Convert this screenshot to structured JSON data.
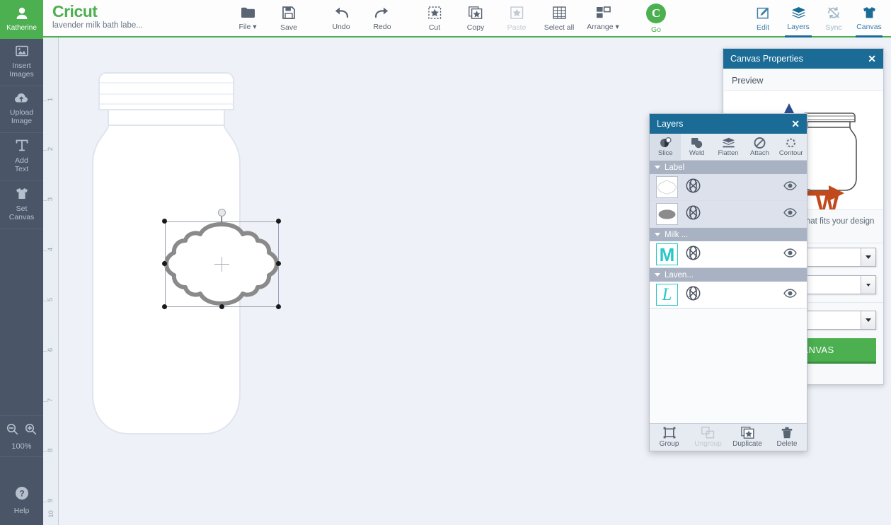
{
  "app": {
    "brand": "Cricut",
    "project_title": "lavender milk bath labe..."
  },
  "user": {
    "name": "Katherine",
    "avatar_icon": "person-icon",
    "caret_icon": "chevron-down-icon"
  },
  "left_rail": {
    "items": [
      {
        "label_line1": "Insert",
        "label_line2": "Images",
        "icon": "image-icon"
      },
      {
        "label_line1": "Upload",
        "label_line2": "Image",
        "icon": "cloud-upload-icon"
      },
      {
        "label_line1": "Add",
        "label_line2": "Text",
        "icon": "text-t-icon"
      },
      {
        "label_line1": "Set",
        "label_line2": "Canvas",
        "icon": "tshirt-icon"
      }
    ],
    "zoom_out_icon": "zoom-out-icon",
    "zoom_in_icon": "zoom-in-icon",
    "zoom_percent": "100%",
    "help_label": "Help",
    "help_icon": "question-mark-icon"
  },
  "toolbar": {
    "items": [
      {
        "label": "File",
        "icon": "folder-icon",
        "disabled": false,
        "has_caret": true
      },
      {
        "label": "Save",
        "icon": "floppy-disk-icon",
        "disabled": false,
        "has_caret": false
      },
      {
        "label": "Undo",
        "icon": "undo-arrow-icon",
        "disabled": false,
        "has_caret": false
      },
      {
        "label": "Redo",
        "icon": "redo-arrow-icon",
        "disabled": false,
        "has_caret": false
      },
      {
        "label": "Cut",
        "icon": "cut-icon",
        "disabled": false,
        "has_caret": false
      },
      {
        "label": "Copy",
        "icon": "copy-icon",
        "disabled": false,
        "has_caret": false
      },
      {
        "label": "Paste",
        "icon": "paste-icon",
        "disabled": true,
        "has_caret": false
      },
      {
        "label": "Select all",
        "icon": "grid-icon",
        "disabled": false,
        "has_caret": false
      },
      {
        "label": "Arrange",
        "icon": "arrange-icon",
        "disabled": false,
        "has_caret": true
      }
    ],
    "go": {
      "label": "Go",
      "icon": "cricut-c-icon"
    }
  },
  "right_tabs": [
    {
      "label": "Edit",
      "icon": "pencil-square-icon",
      "active": false,
      "dim": false
    },
    {
      "label": "Layers",
      "icon": "layers-stack-icon",
      "active": true,
      "dim": false
    },
    {
      "label": "Sync",
      "icon": "sync-slash-icon",
      "active": false,
      "dim": true
    },
    {
      "label": "Canvas",
      "icon": "tshirt-icon",
      "active": true,
      "dim": false
    }
  ],
  "ruler": {
    "ticks": [
      "1",
      "2",
      "3",
      "4",
      "5",
      "6",
      "7",
      "8",
      "9",
      "10"
    ]
  },
  "canvas": {
    "artwork_name": "mason-jar-outline",
    "selected_shape_name": "ornate-label-shape",
    "selection": {
      "handles": 8,
      "rotate_handle_icon": "rotate-handle-icon",
      "center_icon": "center-crosshair-icon"
    }
  },
  "canvas_properties": {
    "title": "Canvas Properties",
    "close_icon": "close-icon",
    "preview_label": "Preview",
    "preview_icon": "jar-dimension-preview",
    "hint_text": "Choose the canvas that fits your design best.",
    "fields": [
      {
        "name": "category-select",
        "value": "",
        "arrow_icon": "chevron-down-icon",
        "size": "normal"
      },
      {
        "name": "type-select",
        "value": "",
        "arrow_icon": "chevron-down-icon",
        "size": "small"
      },
      {
        "name": "size-select",
        "value": "",
        "arrow_icon": "chevron-down-icon",
        "size": "normal"
      }
    ],
    "button_label": "SET CANVAS",
    "button_color": "#4caf50"
  },
  "layers_panel": {
    "title": "Layers",
    "close_icon": "close-icon",
    "operations": [
      {
        "label": "Slice",
        "icon": "slice-icon",
        "selected": true
      },
      {
        "label": "Weld",
        "icon": "weld-icon",
        "selected": false
      },
      {
        "label": "Flatten",
        "icon": "flatten-icon",
        "selected": false
      },
      {
        "label": "Attach",
        "icon": "attach-icon",
        "selected": false
      },
      {
        "label": "Contour",
        "icon": "contour-icon",
        "selected": false
      }
    ],
    "groups": [
      {
        "name": "Label",
        "caret_icon": "caret-down-icon",
        "rows": [
          {
            "thumb": "ornate-outline-thumb",
            "thumb_type": "outline",
            "cut_icon": "cut-type-icon",
            "eye_icon": "eye-icon",
            "shaded": true,
            "teal": false
          },
          {
            "thumb": "filled-gray-shape-thumb",
            "thumb_type": "filled",
            "cut_icon": "cut-type-icon",
            "eye_icon": "eye-icon",
            "shaded": true,
            "teal": false
          }
        ]
      },
      {
        "name": "Milk ...",
        "caret_icon": "caret-down-icon",
        "rows": [
          {
            "thumb": "M",
            "thumb_type": "letter",
            "cut_icon": "cut-type-icon",
            "eye_icon": "eye-icon",
            "shaded": false,
            "teal": true
          }
        ]
      },
      {
        "name": "Laven...",
        "caret_icon": "caret-down-icon",
        "rows": [
          {
            "thumb": "L",
            "thumb_type": "script",
            "cut_icon": "cut-type-icon",
            "eye_icon": "eye-icon",
            "shaded": false,
            "teal": true
          }
        ]
      }
    ],
    "actions": [
      {
        "label": "Group",
        "icon": "group-icon",
        "disabled": false
      },
      {
        "label": "Ungroup",
        "icon": "ungroup-icon",
        "disabled": true
      },
      {
        "label": "Duplicate",
        "icon": "duplicate-icon",
        "disabled": false
      },
      {
        "label": "Delete",
        "icon": "trash-icon",
        "disabled": false
      }
    ]
  },
  "colors": {
    "brand_green": "#4caf50",
    "panel_blue": "#1a6b96",
    "rail_dark": "#4a5568",
    "canvas_bg": "#eef1f7",
    "teal_accent": "#28c8c8",
    "group_header": "#a8b2c2"
  }
}
